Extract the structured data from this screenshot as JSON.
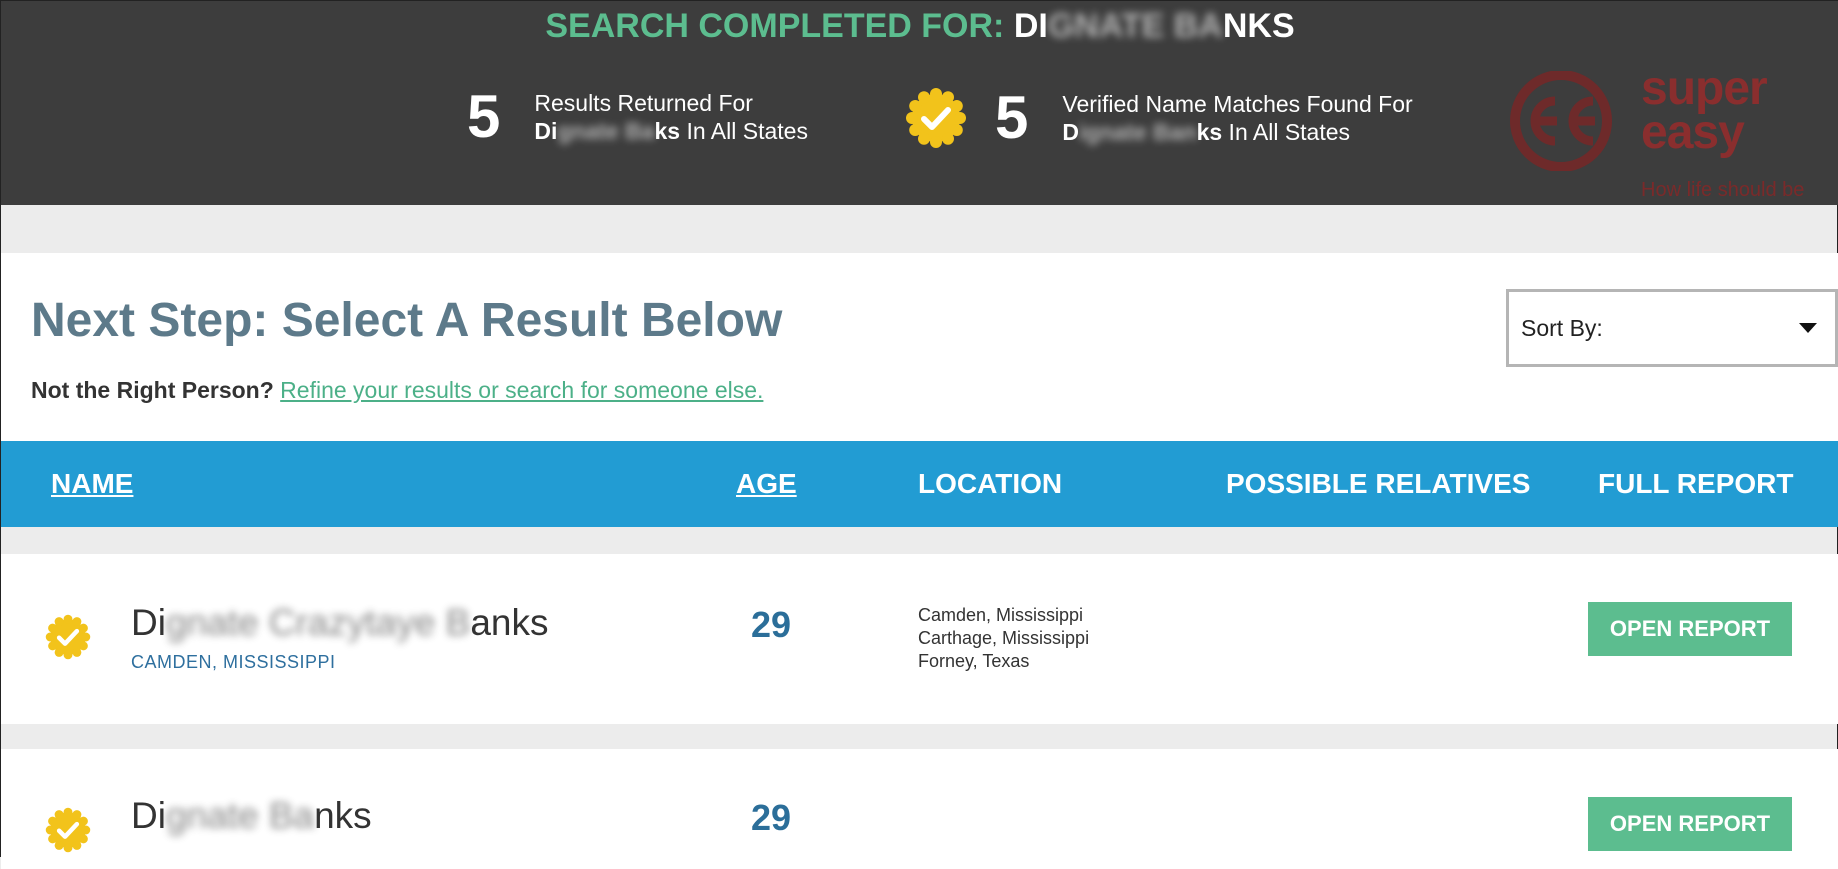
{
  "header": {
    "search_prefix": "SEARCH COMPLETED FOR: ",
    "search_name_start": "DI",
    "search_name_blur": "GNATE BA",
    "search_name_end": "NKS",
    "results": {
      "count": "5",
      "line1": "Results Returned For",
      "name_start": "Di",
      "name_blur": "gnate Ba",
      "name_end": "ks",
      "suffix": " In All States"
    },
    "verified": {
      "count": "5",
      "line1": "Verified Name Matches Found For",
      "name_start": "D",
      "name_blur": "ignate Ban",
      "name_end": "ks",
      "suffix": " In All States"
    },
    "logo": {
      "brand_line1": "super",
      "brand_line2": "easy",
      "tagline": "How life should be"
    }
  },
  "panel": {
    "title": "Next Step: Select A Result Below",
    "question": "Not the Right Person?",
    "refine_link": "Refine your results or search for someone else.",
    "sort_label": "Sort By:"
  },
  "table_header": {
    "name": "NAME",
    "age": "AGE",
    "location": "LOCATION",
    "relatives": "POSSIBLE RELATIVES",
    "report": "FULL REPORT"
  },
  "rows": [
    {
      "name_start": "Di",
      "name_blur": "gnate Crazytaye B",
      "name_end": "anks",
      "city": "CAMDEN, MISSISSIPPI",
      "age": "29",
      "locations": [
        "Camden, Mississippi",
        "Carthage, Mississippi",
        "Forney, Texas"
      ],
      "button": "OPEN REPORT"
    },
    {
      "name_start": "Di",
      "name_blur": "gnate Ba",
      "name_end": "nks",
      "age": "29",
      "button": "OPEN REPORT"
    }
  ],
  "colors": {
    "header_bg": "#3d3d3d",
    "accent_green": "#5cbd8f",
    "table_blue": "#229cd3",
    "title_slate": "#5d7a8a",
    "age_blue": "#2b6e99",
    "badge_yellow": "#f2c31b"
  },
  "icons": {
    "verified": "check-badge-icon",
    "sort_caret": "caret-down-icon"
  }
}
